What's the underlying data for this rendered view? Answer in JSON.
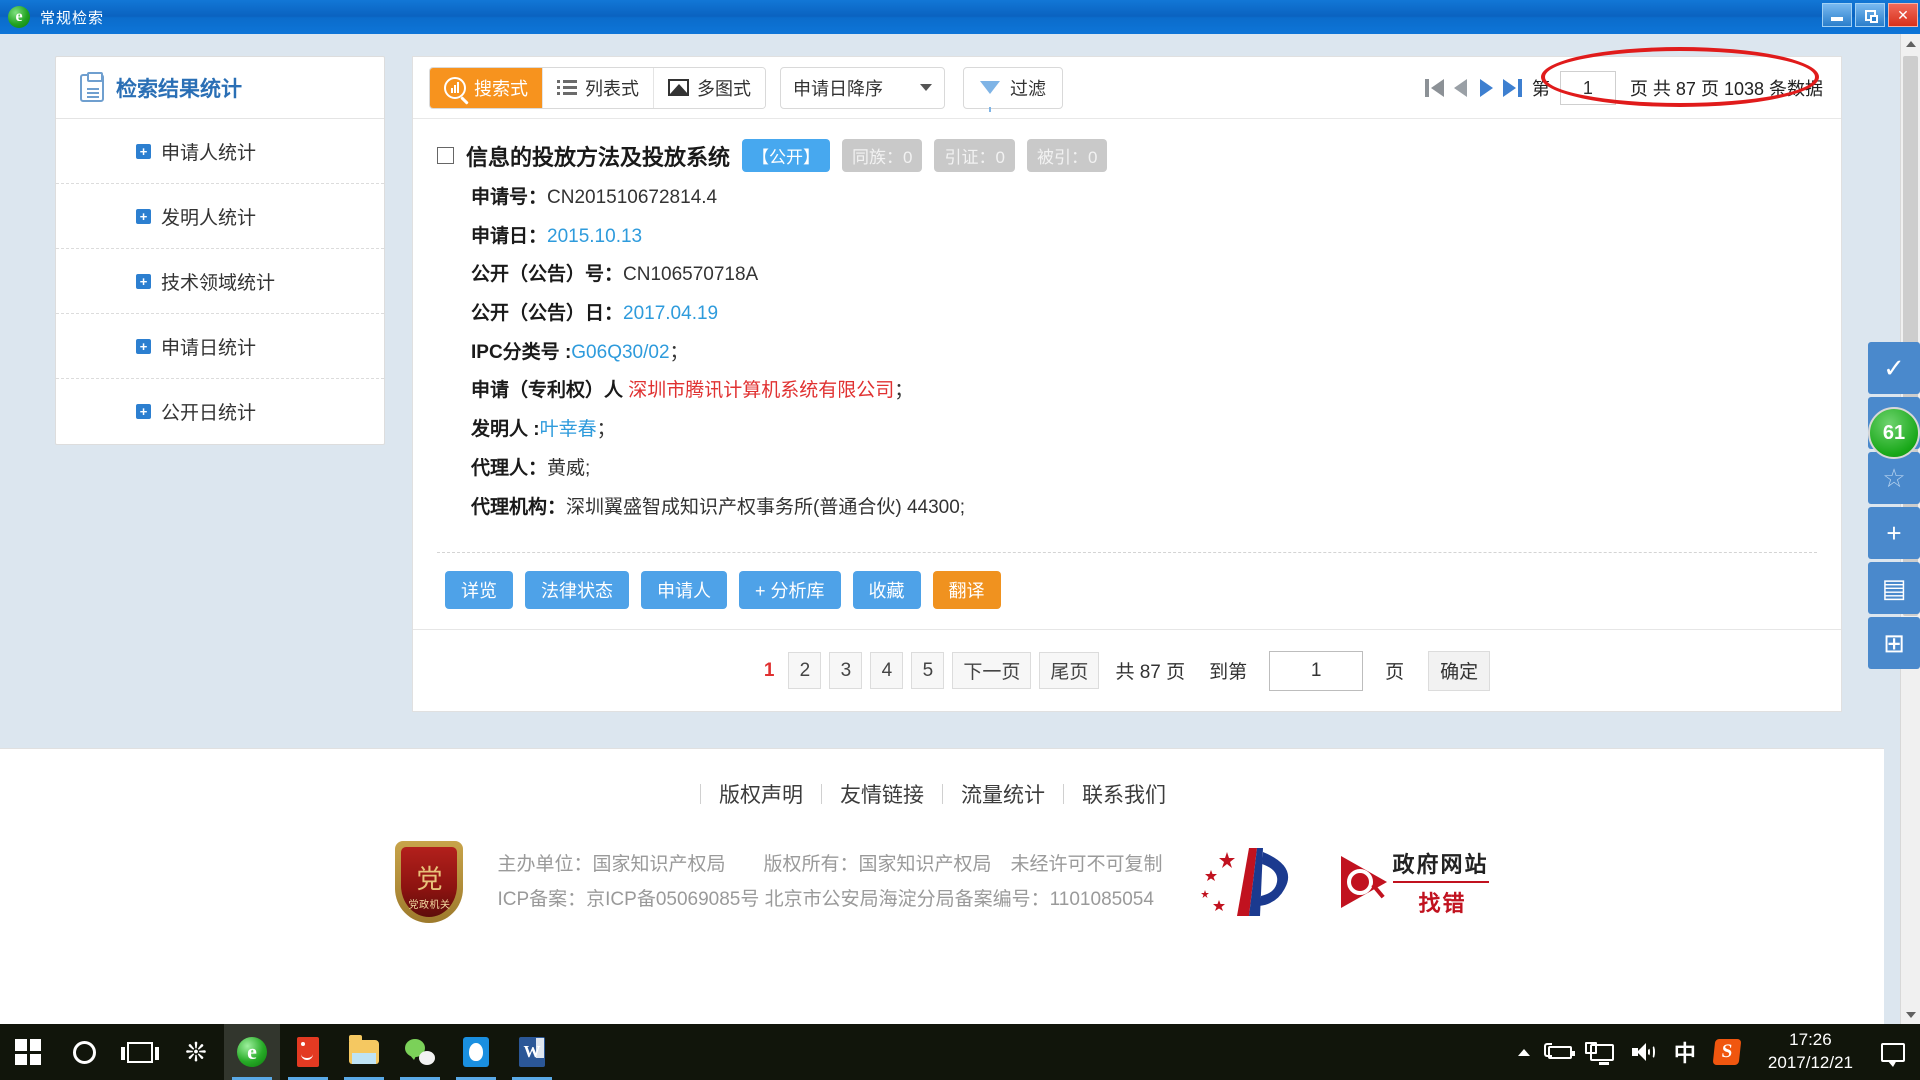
{
  "window": {
    "title": "常规检索",
    "logo_icon": "ie-logo-icon",
    "minimize_label": "最小化",
    "maximize_label": "最大化",
    "close_label": "关闭"
  },
  "sidebar": {
    "header": {
      "title": "检索结果统计",
      "icon": "clipboard-icon"
    },
    "items": [
      {
        "label": "申请人统计",
        "expander": "+"
      },
      {
        "label": "发明人统计",
        "expander": "+"
      },
      {
        "label": "技术领域统计",
        "expander": "+"
      },
      {
        "label": "申请日统计",
        "expander": "+"
      },
      {
        "label": "公开日统计",
        "expander": "+"
      }
    ]
  },
  "toolbar": {
    "view_modes": [
      {
        "label": "搜索式",
        "icon": "search-chart-icon",
        "active": true
      },
      {
        "label": "列表式",
        "icon": "list-icon",
        "active": false
      },
      {
        "label": "多图式",
        "icon": "image-grid-icon",
        "active": false
      }
    ],
    "sort": {
      "value": "申请日降序",
      "caret_icon": "chevron-down-icon"
    },
    "filter": {
      "label": "过滤",
      "icon": "funnel-icon"
    }
  },
  "top_pager": {
    "first_icon": "first-page-icon",
    "prev_icon": "prev-page-icon",
    "next_icon": "next-page-icon",
    "last_icon": "last-page-icon",
    "prefix": "第",
    "page_value": "1",
    "summary": "页 共 87 页 1038 条数据",
    "annotation": "red-ellipse-highlight"
  },
  "record": {
    "checkbox_checked": false,
    "title": "信息的投放方法及投放系统",
    "badges": [
      {
        "label": "【公开】",
        "style": "blue"
      },
      {
        "label": "同族：0",
        "style": "gray"
      },
      {
        "label": "引证：0",
        "style": "gray"
      },
      {
        "label": "被引：0",
        "style": "gray"
      }
    ],
    "fields": [
      {
        "label": "申请号：",
        "value": "CN201510672814.4",
        "color": "dark",
        "suffix": ""
      },
      {
        "label": "申请日：",
        "value": "2015.10.13",
        "color": "blue",
        "suffix": ""
      },
      {
        "label": "公开（公告）号：",
        "value": "CN106570718A",
        "color": "dark",
        "suffix": ""
      },
      {
        "label": "公开（公告）日：",
        "value": "2017.04.19",
        "color": "blue",
        "suffix": ""
      },
      {
        "label": "IPC分类号 :",
        "value": "G06Q30/02",
        "color": "blue",
        "suffix": "；"
      },
      {
        "label": "申请（专利权）人 ",
        "value": "深圳市腾讯计算机系统有限公司",
        "color": "red",
        "suffix": "；"
      },
      {
        "label": "发明人 :",
        "value": "叶幸春",
        "color": "blue",
        "suffix": "；"
      },
      {
        "label": "代理人：",
        "value": "黄威;",
        "color": "dark",
        "suffix": ""
      },
      {
        "label": "代理机构：",
        "value": "深圳翼盛智成知识产权事务所(普通合伙) 44300;",
        "color": "dark",
        "suffix": ""
      }
    ],
    "actions": [
      {
        "label": "详览",
        "style": "blue"
      },
      {
        "label": "法律状态",
        "style": "blue"
      },
      {
        "label": "申请人",
        "style": "blue"
      },
      {
        "label": "+ 分析库",
        "style": "blue"
      },
      {
        "label": "收藏",
        "style": "blue"
      },
      {
        "label": "翻译",
        "style": "orange"
      }
    ]
  },
  "bottom_pager": {
    "pages": [
      "1",
      "2",
      "3",
      "4",
      "5"
    ],
    "current_page": "1",
    "next_label": "下一页",
    "last_label": "尾页",
    "total_text": "共 87 页",
    "jump_prefix": "到第",
    "jump_value": "1",
    "jump_suffix": "页",
    "confirm_label": "确定"
  },
  "footer": {
    "links": [
      "版权声明",
      "友情链接",
      "流量统计",
      "联系我们"
    ],
    "shield": {
      "glyph": "党",
      "text": "党政机关"
    },
    "line1": "主办单位：国家知识产权局　　版权所有：国家知识产权局　未经许可不可复制",
    "line2": "ICP备案：京ICP备05069085号 北京市公安局海淀分局备案编号：1101085054",
    "logos": [
      {
        "name": "stars-p-emblem",
        "alt": "五星P徽标"
      },
      {
        "name": "gov-site-report-logo",
        "title": "政府网站",
        "subtitle": "找错"
      }
    ]
  },
  "right_rail": {
    "buttons": [
      {
        "icon": "check-icon",
        "glyph": "✓",
        "faded": false
      },
      {
        "icon": "menu-lines-icon",
        "glyph": "☰",
        "faded": false
      },
      {
        "icon": "star-icon",
        "glyph": "☆",
        "faded": true
      },
      {
        "icon": "plus-icon",
        "glyph": "+",
        "faded": false
      },
      {
        "icon": "document-list-icon",
        "glyph": "▤",
        "faded": false
      },
      {
        "icon": "add-box-icon",
        "glyph": "⊞",
        "faded": false
      }
    ],
    "badge_count": "61"
  },
  "taskbar": {
    "items": [
      {
        "name": "start-button",
        "icon": "windows-logo-icon"
      },
      {
        "name": "cortana-search",
        "icon": "cortana-ring-icon"
      },
      {
        "name": "task-view",
        "icon": "task-view-icon"
      },
      {
        "name": "pinwheel-app",
        "icon": "pinwheel-icon"
      },
      {
        "name": "internet-explorer",
        "icon": "ie-icon",
        "active": true,
        "running": true
      },
      {
        "name": "foxmail",
        "icon": "foxmail-icon",
        "running": true
      },
      {
        "name": "file-explorer",
        "icon": "folder-icon",
        "running": true
      },
      {
        "name": "wechat",
        "icon": "wechat-icon",
        "running": true
      },
      {
        "name": "qq",
        "icon": "qq-penguin-icon",
        "running": true
      },
      {
        "name": "word",
        "icon": "word-icon",
        "running": true
      }
    ],
    "tray": {
      "chevron_icon": "show-hidden-icons-icon",
      "battery_icon": "battery-charging-icon",
      "network_icon": "network-icon",
      "volume_icon": "volume-icon",
      "ime_label": "中",
      "sogou_label": "S",
      "time": "17:26",
      "date": "2017/12/21",
      "notification_icon": "action-center-icon"
    }
  }
}
